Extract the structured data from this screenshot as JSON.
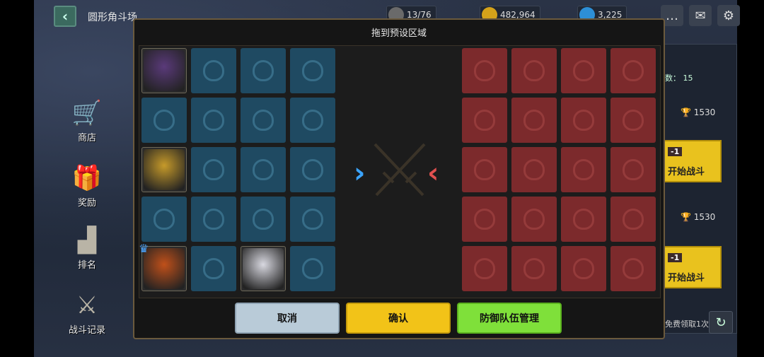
{
  "topbar": {
    "page_title": "圆形角斗场",
    "stamina": "13/76",
    "gold": "482,964",
    "gems": "3,225"
  },
  "sidebar": {
    "items": [
      {
        "label": "商店",
        "icon": "cart-icon"
      },
      {
        "label": "奖励",
        "icon": "gift-icon"
      },
      {
        "label": "排名",
        "icon": "podium-icon"
      },
      {
        "label": "战斗记录",
        "icon": "battle-log-icon"
      }
    ]
  },
  "right_panel": {
    "count_label": "数： 15",
    "entries": [
      {
        "trophy": "1530",
        "cost": "-1",
        "button": "开始战斗"
      },
      {
        "trophy": "1530",
        "cost": "-1",
        "button": "开始战斗"
      }
    ],
    "free_text": "免费领取1次"
  },
  "modal": {
    "title": "拖到预设区域",
    "cancel_label": "取消",
    "confirm_label": "确认",
    "manage_label": "防御队伍管理"
  },
  "colors": {
    "blue_cell": "#1f4a62",
    "red_cell": "#7c2a2c",
    "cancel": "#b9cbd8",
    "confirm": "#f2c318",
    "manage": "#7fe03a"
  }
}
